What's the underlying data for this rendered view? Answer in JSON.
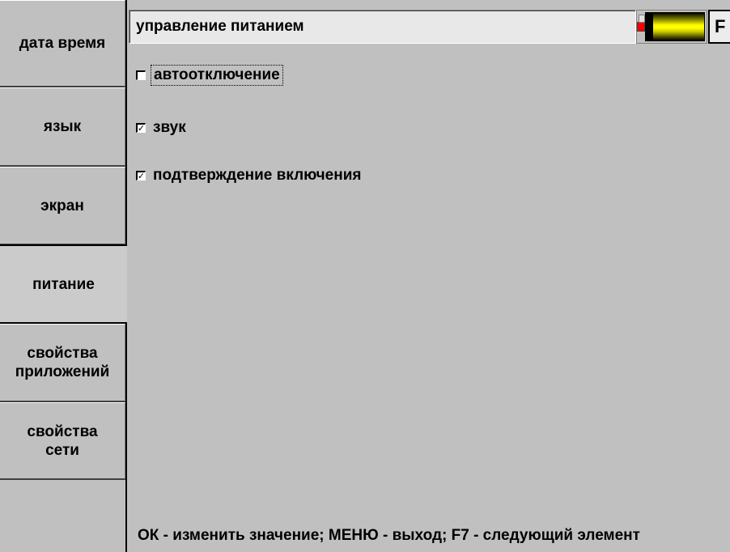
{
  "menu": {
    "items": [
      {
        "label": "дата время"
      },
      {
        "label": "язык"
      },
      {
        "label": "экран"
      },
      {
        "label": "питание"
      },
      {
        "label": "свойства приложений"
      },
      {
        "label": "свойства сети"
      }
    ],
    "active_index": 3
  },
  "header": {
    "title": "управление питанием",
    "fkey_label": "F",
    "battery_level": 0.88,
    "battery_fill_color": "#ffff00",
    "battery_tip_color": "#ff0000"
  },
  "options": [
    {
      "label": "автоотключение",
      "checked": false,
      "focused": true
    },
    {
      "label": "звук",
      "checked": true,
      "focused": false
    },
    {
      "label": "подтверждение включения",
      "checked": true,
      "focused": false
    }
  ],
  "check_mark": "✓",
  "hint": "ОК - изменить значение; МЕНЮ - выход; F7 - следующий элемент",
  "colors": {
    "background": "#c0c0c0",
    "field_background": "#e8e8e8"
  }
}
